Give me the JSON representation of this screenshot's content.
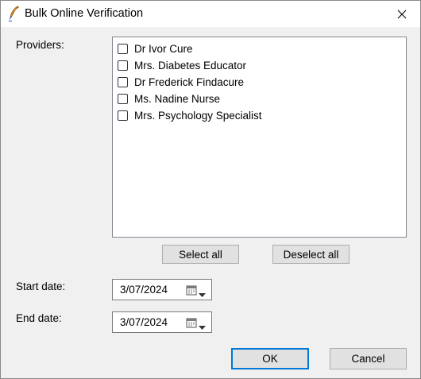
{
  "window": {
    "title": "Bulk Online Verification"
  },
  "providers": {
    "label": "Providers:",
    "items": [
      {
        "label": "Dr Ivor Cure",
        "checked": false
      },
      {
        "label": "Mrs. Diabetes Educator",
        "checked": false
      },
      {
        "label": "Dr Frederick Findacure",
        "checked": false
      },
      {
        "label": "Ms. Nadine Nurse",
        "checked": false
      },
      {
        "label": "Mrs. Psychology Specialist",
        "checked": false
      }
    ],
    "select_all_label": "Select all",
    "deselect_all_label": "Deselect all"
  },
  "start_date": {
    "label": "Start date:",
    "value": "3/07/2024"
  },
  "end_date": {
    "label": "End date:",
    "value": "3/07/2024"
  },
  "footer": {
    "ok_label": "OK",
    "cancel_label": "Cancel"
  },
  "icons": {
    "app": "quill-pen-icon",
    "close": "close-icon",
    "calendar": "calendar-icon",
    "dropdown": "chevron-down-icon"
  },
  "colors": {
    "dialog_bg": "#f0f0f0",
    "titlebar_bg": "#ffffff",
    "button_bg": "#e1e1e1",
    "default_button_border": "#0078d7"
  }
}
